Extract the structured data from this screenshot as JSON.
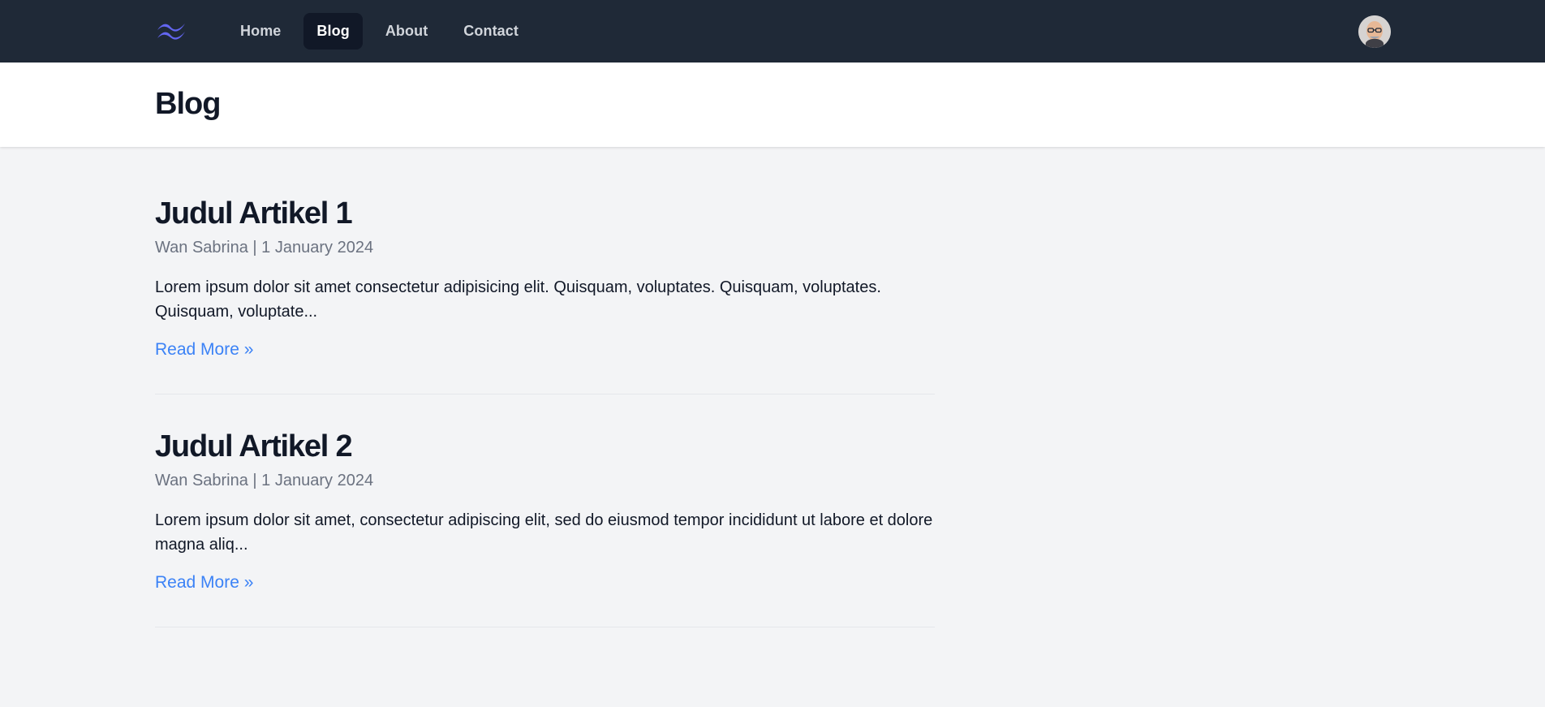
{
  "nav": {
    "logo_icon": "tailwind-wave-icon",
    "links": [
      {
        "label": "Home",
        "active": false
      },
      {
        "label": "Blog",
        "active": true
      },
      {
        "label": "About",
        "active": false
      },
      {
        "label": "Contact",
        "active": false
      }
    ],
    "avatar_icon": "user-avatar"
  },
  "header": {
    "title": "Blog"
  },
  "articles": [
    {
      "title": "Judul Artikel 1",
      "author": "Wan Sabrina",
      "date": "1 January 2024",
      "meta": "Wan Sabrina | 1 January 2024",
      "excerpt": "Lorem ipsum dolor sit amet consectetur adipisicing elit. Quisquam, voluptates. Quisquam, voluptates. Quisquam, voluptate...",
      "read_more": "Read More »"
    },
    {
      "title": "Judul Artikel 2",
      "author": "Wan Sabrina",
      "date": "1 January 2024",
      "meta": "Wan Sabrina | 1 January 2024",
      "excerpt": "Lorem ipsum dolor sit amet, consectetur adipiscing elit, sed do eiusmod tempor incididunt ut labore et dolore magna aliq...",
      "read_more": "Read More »"
    }
  ],
  "colors": {
    "nav_bg": "#1f2937",
    "nav_active_bg": "#111827",
    "page_bg": "#f3f4f6",
    "link": "#3b82f6",
    "logo": "#6366f1"
  }
}
